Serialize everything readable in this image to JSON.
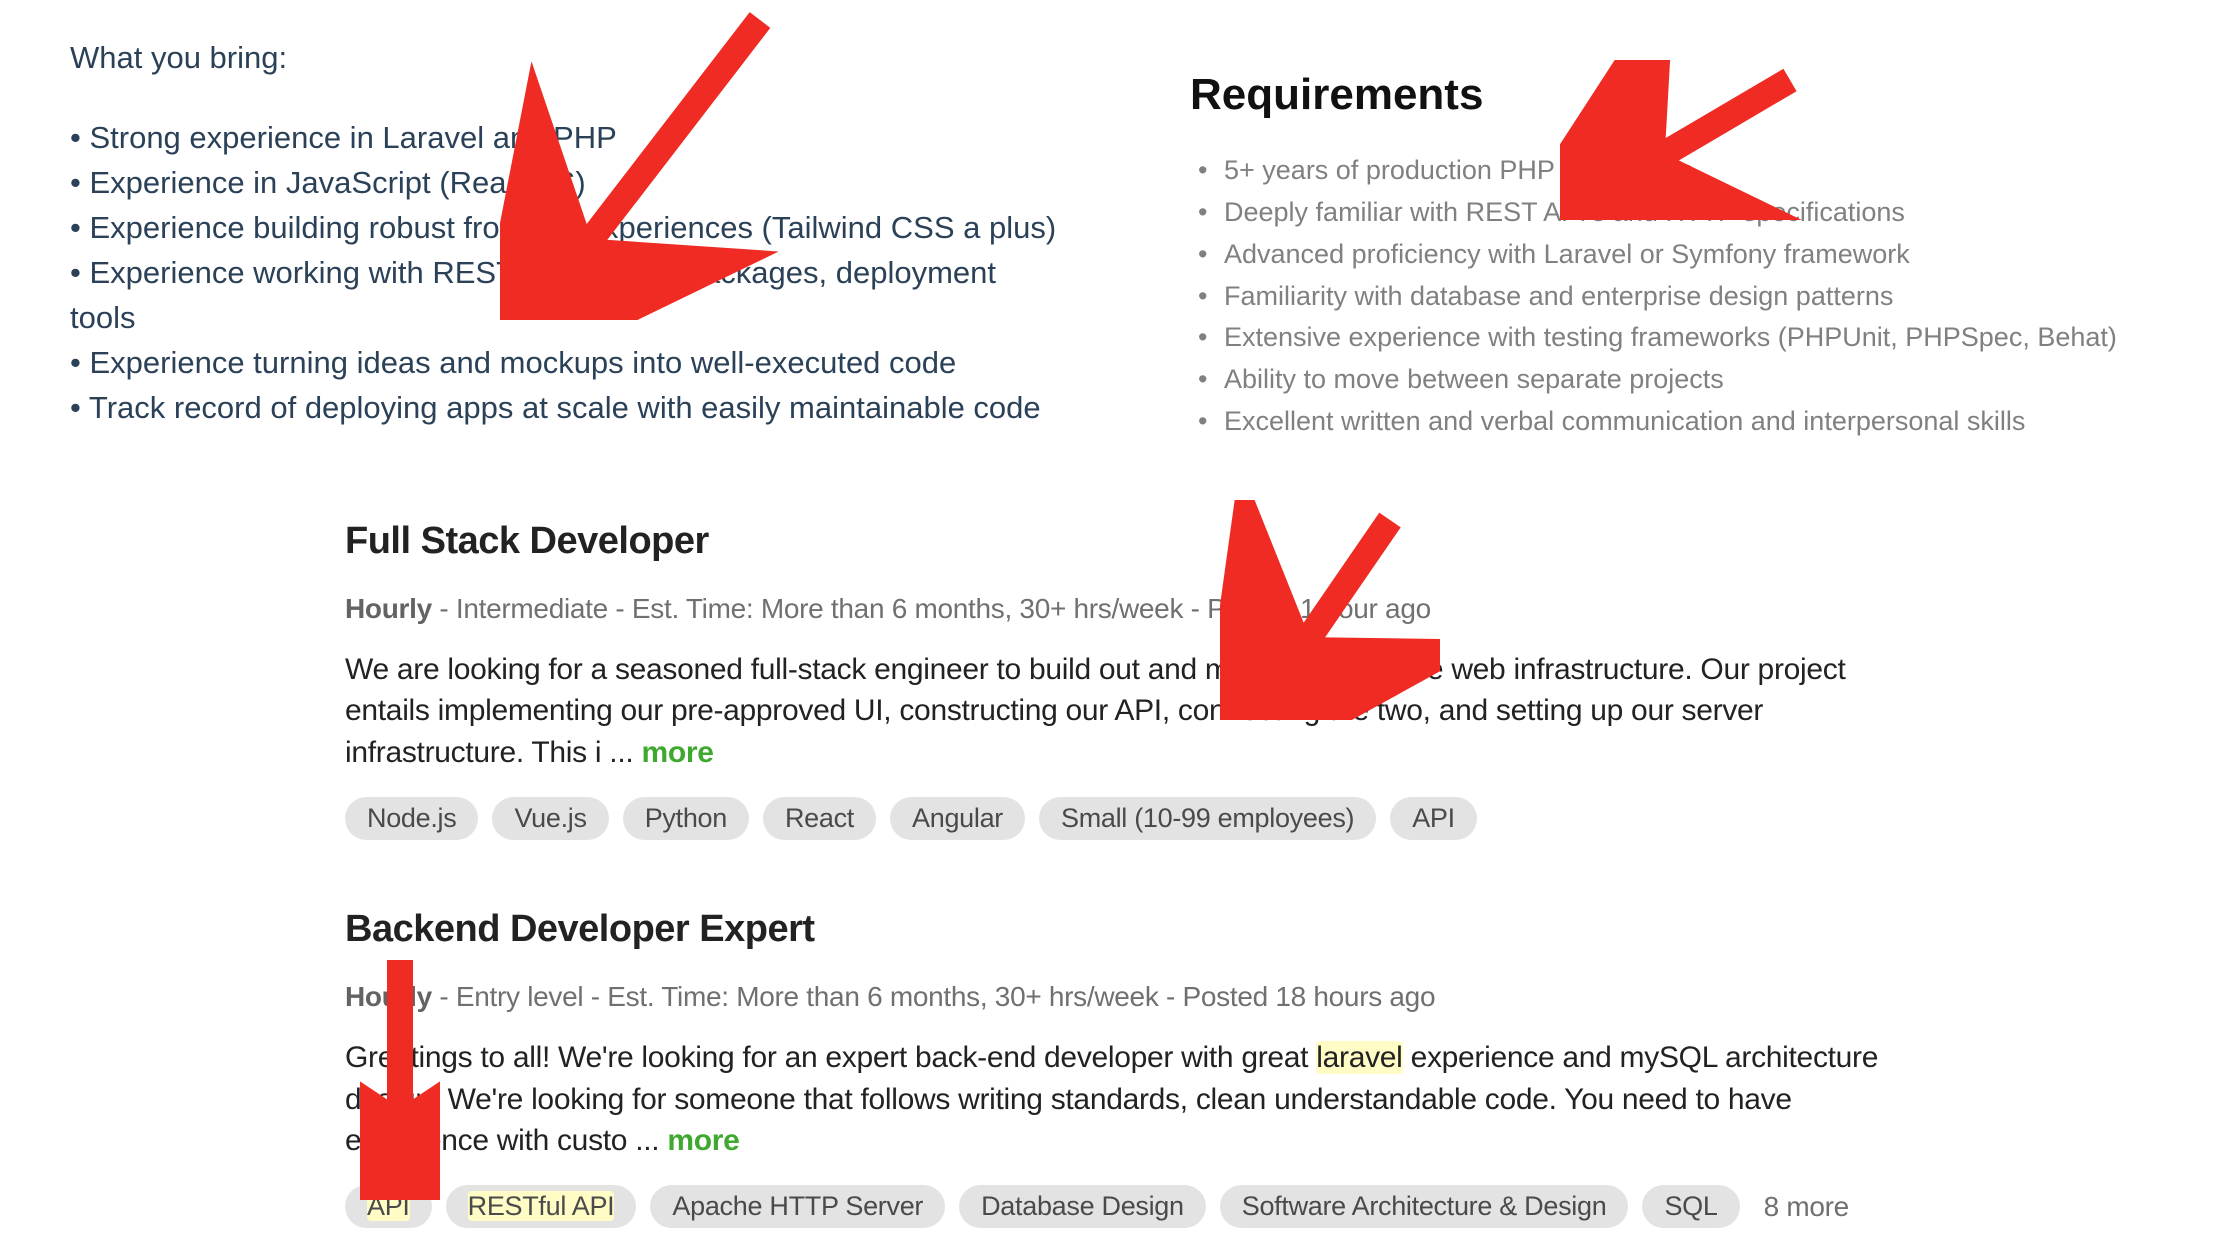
{
  "topleft": {
    "intro": "What you bring:",
    "items": [
      "• Strong experience in Laravel and PHP",
      "• Experience in JavaScript (React.JS)",
      "• Experience building robust frontend experiences (Tailwind CSS a plus)",
      "• Experience working with REST API's, code packages, deployment tools",
      "• Experience turning ideas and mockups into well-executed code",
      "• Track record of deploying apps at scale with easily maintainable code"
    ]
  },
  "topright": {
    "heading": "Requirements",
    "items": [
      "5+ years of production PHP experience",
      "Deeply familiar with REST API's and HTTP specifications",
      "Advanced proficiency with Laravel or Symfony framework",
      "Familiarity with database and enterprise design patterns",
      "Extensive experience with testing frameworks (PHPUnit, PHPSpec, Behat)",
      "Ability to move between separate projects",
      "Excellent written and verbal communication and interpersonal skills"
    ]
  },
  "jobs": [
    {
      "title": "Full Stack Developer",
      "hourly": "Hourly",
      "meta_rest": " - Intermediate - Est. Time: More than 6 months, 30+ hrs/week - Posted 1 hour ago",
      "desc_before": "We are looking for a seasoned full-stack engineer to build out and manage our entire web infrastructure. Our project entails implementing our pre-approved UI, constructing our API, connecting the two, and setting up our server infrastructure. This i ... ",
      "more": "more",
      "tags": [
        "Node.js",
        "Vue.js",
        "Python",
        "React",
        "Angular",
        "Small (10-99 employees)",
        "API"
      ]
    },
    {
      "title": "Backend Developer Expert",
      "hourly": "Hourly",
      "meta_rest": " - Entry level - Est. Time: More than 6 months, 30+ hrs/week - Posted 18 hours ago",
      "desc_p1": "Greetings to all! We're looking for an expert back-end developer with great ",
      "desc_hl": "laravel",
      "desc_p2": " experience and mySQL architecture design. We're looking for someone that follows writing standards, clean understandable code. You need to have experience with custo ... ",
      "more": "more",
      "tags_hl": [
        "API",
        "RESTful API"
      ],
      "tags": [
        "Apache HTTP Server",
        "Database Design",
        "Software Architecture & Design",
        "SQL"
      ],
      "more_tags": "8 more"
    }
  ]
}
